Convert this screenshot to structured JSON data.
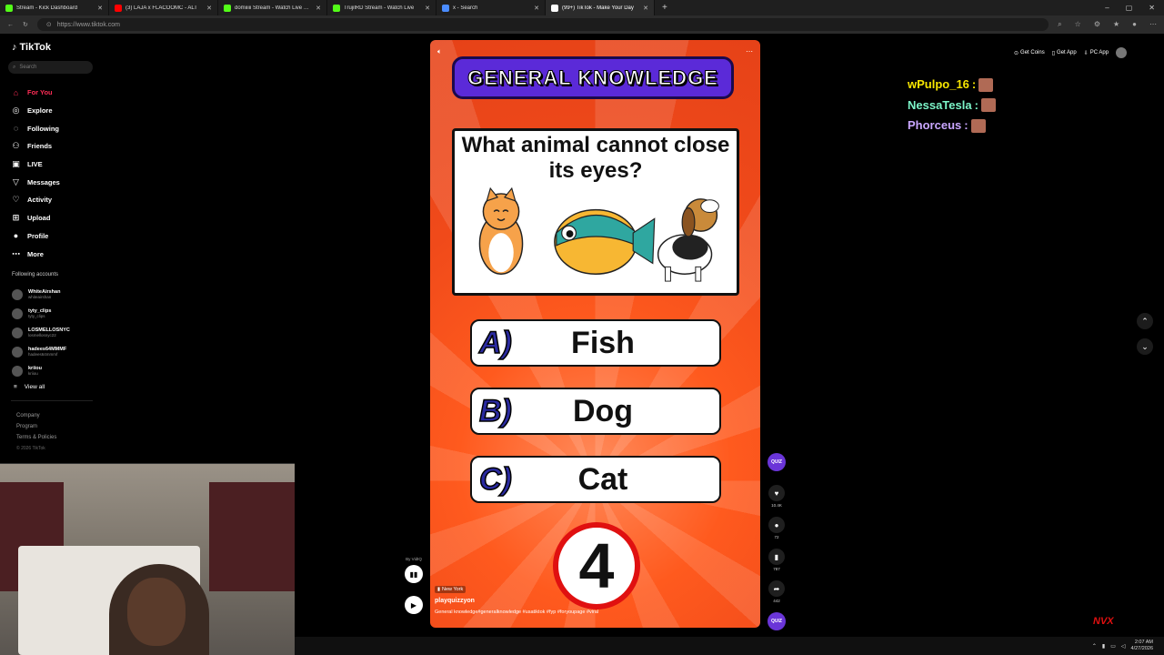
{
  "browser": {
    "tabs": [
      {
        "title": "Stream - Kick Dashboard",
        "color": "#53fc18"
      },
      {
        "title": "(3) LAJA x FLACOOMC - ALT",
        "color": "#ff0000"
      },
      {
        "title": "domiiiii Stream - Watch Live on Ki",
        "color": "#53fc18"
      },
      {
        "title": "TrujilRD Stream - Watch Live",
        "color": "#53fc18"
      },
      {
        "title": "x - Search",
        "color": "#4a8cff"
      },
      {
        "title": "(99+) TikTok - Make Your Day",
        "color": "#ffffff",
        "active": true
      }
    ],
    "url": "https://www.tiktok.com"
  },
  "tiktok": {
    "logo": "TikTok",
    "search_placeholder": "Search",
    "nav": [
      {
        "label": "For You",
        "icon": "home-icon",
        "active": true
      },
      {
        "label": "Explore",
        "icon": "compass-icon"
      },
      {
        "label": "Following",
        "icon": "following-icon"
      },
      {
        "label": "Friends",
        "icon": "friends-icon"
      },
      {
        "label": "LIVE",
        "icon": "live-icon"
      },
      {
        "label": "Messages",
        "icon": "messages-icon"
      },
      {
        "label": "Activity",
        "icon": "activity-icon"
      },
      {
        "label": "Upload",
        "icon": "upload-icon"
      },
      {
        "label": "Profile",
        "icon": "profile-icon"
      },
      {
        "label": "More",
        "icon": "more-icon"
      }
    ],
    "following_title": "Following accounts",
    "following": [
      {
        "name": "WhiteAirshan",
        "handle": "whiteairshan"
      },
      {
        "name": "tyty_clips",
        "handle": "tyty_clips"
      },
      {
        "name": "LOSMELLOSNYC",
        "handle": "losmellosnyc22"
      },
      {
        "name": "hadees64MMMF",
        "handle": "hadees64mmmf"
      },
      {
        "name": "kriiou",
        "handle": "kriiou"
      }
    ],
    "view_all": "View all",
    "footer": [
      "Company",
      "Program",
      "Terms & Policies"
    ],
    "copyright": "© 2026 TikTok",
    "top_actions": {
      "coins": "Get Coins",
      "app": "Get App",
      "pc": "PC App"
    }
  },
  "video": {
    "banner": "GENERAL KNOWLEDGE",
    "question": "What animal cannot close its eyes?",
    "answers": [
      {
        "letter": "A)",
        "text": "Fish"
      },
      {
        "letter": "B)",
        "text": "Dog"
      },
      {
        "letter": "C)",
        "text": "Cat"
      }
    ],
    "timer": "4",
    "location": "New York",
    "author": "playquizzyon",
    "description": "General knowledge#generalknowledge #usatiktok #fyp #foryoupage #viral",
    "by_label": "By VidIQ",
    "stats": {
      "likes": "10.4K",
      "comments": "72",
      "saves": "787",
      "shares": "442"
    },
    "avatar_label": "QUIZ"
  },
  "chat": [
    {
      "user": "wPulpo_16",
      "color": "#f7e600"
    },
    {
      "user": "NessaTesla",
      "color": "#7cf5c8"
    },
    {
      "user": "Phorceus",
      "color": "#c9a6ff"
    }
  ],
  "overlay": {
    "brand": "NVX"
  },
  "taskbar": {
    "time": "2:07 AM",
    "date": "4/27/2026"
  }
}
